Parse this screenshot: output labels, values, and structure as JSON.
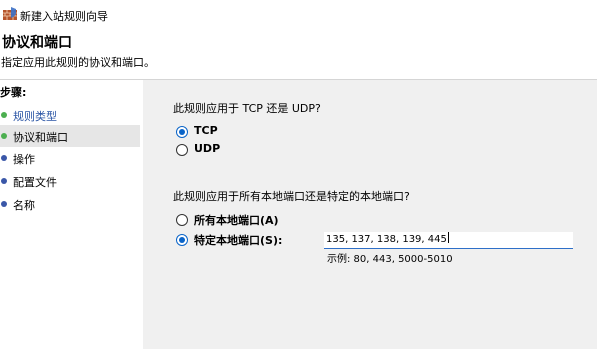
{
  "window": {
    "title": "新建入站规则向导"
  },
  "header": {
    "title": "协议和端口",
    "subtitle": "指定应用此规则的协议和端口。"
  },
  "steps": {
    "heading": "步骤:",
    "items": [
      {
        "label": "规则类型",
        "state": "done"
      },
      {
        "label": "协议和端口",
        "state": "current"
      },
      {
        "label": "操作",
        "state": "pending"
      },
      {
        "label": "配置文件",
        "state": "pending"
      },
      {
        "label": "名称",
        "state": "pending"
      }
    ]
  },
  "protocol": {
    "question": "此规则应用于 TCP 还是 UDP?",
    "options": [
      {
        "label": "TCP",
        "checked": true
      },
      {
        "label": "UDP",
        "checked": false
      }
    ]
  },
  "ports": {
    "question": "此规则应用于所有本地端口还是特定的本地端口?",
    "options": [
      {
        "label": "所有本地端口(A)",
        "checked": false
      },
      {
        "label": "特定本地端口(S):",
        "checked": true
      }
    ],
    "value": "135, 137, 138, 139, 445",
    "example": "示例: 80, 443, 5000-5010"
  },
  "colors": {
    "accent": "#0a64c8",
    "panel": "#f0f0f0",
    "done_step": "#2b55a5"
  },
  "icons": {
    "app": "firewall-wall-icon"
  }
}
